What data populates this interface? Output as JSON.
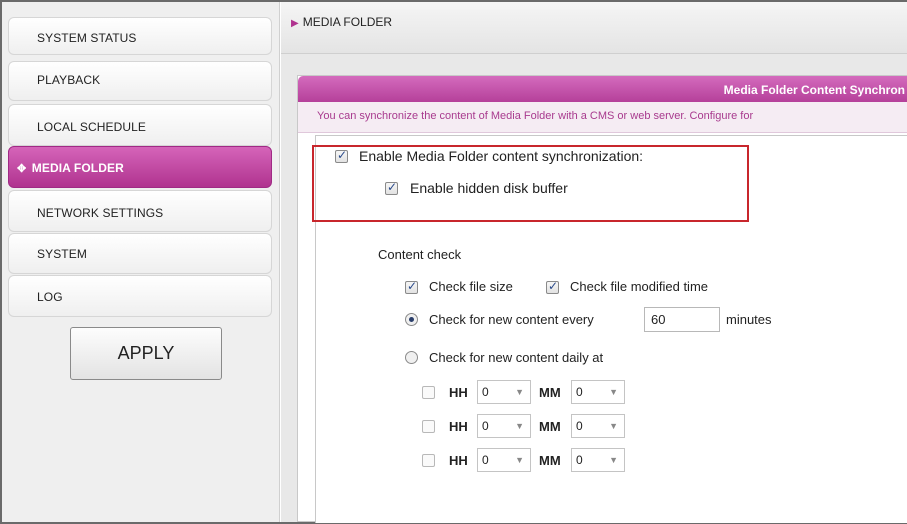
{
  "sidebar": {
    "items": [
      {
        "label": "SYSTEM STATUS",
        "active": false
      },
      {
        "label": "PLAYBACK",
        "active": false
      },
      {
        "label": "LOCAL SCHEDULE",
        "active": false
      },
      {
        "label": "MEDIA FOLDER",
        "active": true
      },
      {
        "label": "NETWORK SETTINGS",
        "active": false
      },
      {
        "label": "SYSTEM",
        "active": false
      },
      {
        "label": "LOG",
        "active": false
      }
    ],
    "apply_label": "APPLY"
  },
  "header": {
    "arrow_icon": "triangle-right-icon",
    "title": "MEDIA FOLDER"
  },
  "panel": {
    "title": "Media Folder Content Synchron",
    "description": "You can synchronize the content of Media Folder with a CMS or web server. Configure for",
    "enable_sync": {
      "label": "Enable Media Folder content synchronization:",
      "checked": true
    },
    "enable_buffer": {
      "label": "Enable hidden disk buffer",
      "checked": true
    },
    "content_check_label": "Content check",
    "check_file_size": {
      "label": "Check file size",
      "checked": true
    },
    "check_modified": {
      "label": "Check file modified time",
      "checked": true
    },
    "interval": {
      "label": "Check for new content every",
      "value": "60",
      "unit": "minutes",
      "selected": true
    },
    "daily": {
      "label": "Check for new content daily at",
      "selected": false
    },
    "time_rows": [
      {
        "checked": false,
        "hh_label": "HH",
        "hh": "0",
        "mm_label": "MM",
        "mm": "0"
      },
      {
        "checked": false,
        "hh_label": "HH",
        "hh": "0",
        "mm_label": "MM",
        "mm": "0"
      },
      {
        "checked": false,
        "hh_label": "HH",
        "hh": "0",
        "mm_label": "MM",
        "mm": "0"
      }
    ]
  },
  "colors": {
    "accent": "#b5409a",
    "highlight": "#c8262c"
  }
}
